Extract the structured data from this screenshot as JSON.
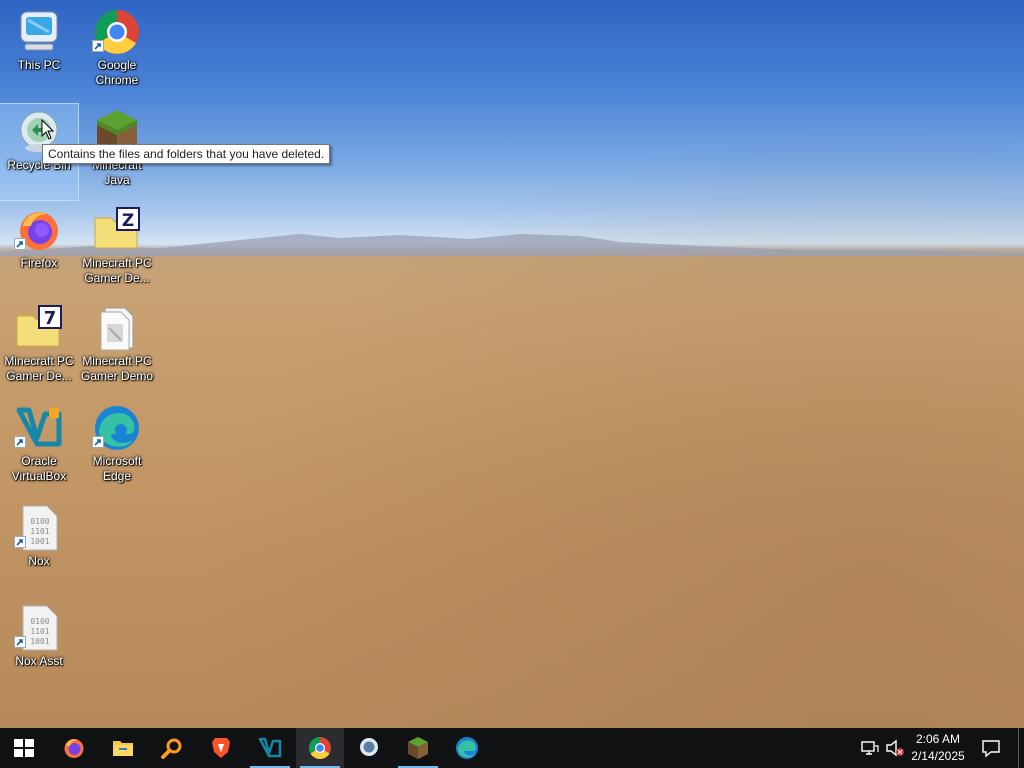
{
  "desktop": {
    "icons": [
      {
        "label": "This PC",
        "icon": "this-pc-icon"
      },
      {
        "label": "Google Chrome",
        "icon": "chrome-icon"
      },
      {
        "label": "Recycle Bin",
        "icon": "recycle-bin-icon"
      },
      {
        "label": "Minecraft Java",
        "icon": "minecraft-icon"
      },
      {
        "label": "Firefox",
        "icon": "firefox-icon"
      },
      {
        "label": "Minecraft PC Gamer De...",
        "icon": "zip-folder-icon"
      },
      {
        "label": "Minecraft PC Gamer De...",
        "icon": "7zip-folder-icon"
      },
      {
        "label": "Minecraft PC Gamer Demo",
        "icon": "document-icon"
      },
      {
        "label": "Oracle VirtualBox",
        "icon": "virtualbox-icon"
      },
      {
        "label": "Microsoft Edge",
        "icon": "edge-icon"
      },
      {
        "label": "Nox",
        "icon": "binary-file-icon"
      },
      {
        "label": "Nox Asst",
        "icon": "binary-file-icon"
      }
    ],
    "tooltip": "Contains the files and folders that you have deleted."
  },
  "taskbar": {
    "items": [
      {
        "name": "start-button",
        "icon": "windows-icon"
      },
      {
        "name": "firefox",
        "icon": "firefox-icon"
      },
      {
        "name": "file-explorer",
        "icon": "folder-icon"
      },
      {
        "name": "search",
        "icon": "magnifier-icon"
      },
      {
        "name": "brave",
        "icon": "brave-icon"
      },
      {
        "name": "virtualbox",
        "icon": "virtualbox-icon"
      },
      {
        "name": "chrome",
        "icon": "chrome-icon",
        "active": true
      },
      {
        "name": "recycle-bin",
        "icon": "recycle-bin-icon"
      },
      {
        "name": "minecraft",
        "icon": "minecraft-icon"
      },
      {
        "name": "edge",
        "icon": "edge-icon"
      }
    ],
    "tray": {
      "network_icon": "network-icon",
      "volume_icon": "volume-muted-icon",
      "time": "2:06 AM",
      "date": "2/14/2025",
      "notification_icon": "notification-icon"
    }
  },
  "colors": {
    "taskbar": "#101113",
    "taskbar_accent": "#76b9ed",
    "sky": "#4a82d6",
    "desert": "#c59b6a"
  }
}
